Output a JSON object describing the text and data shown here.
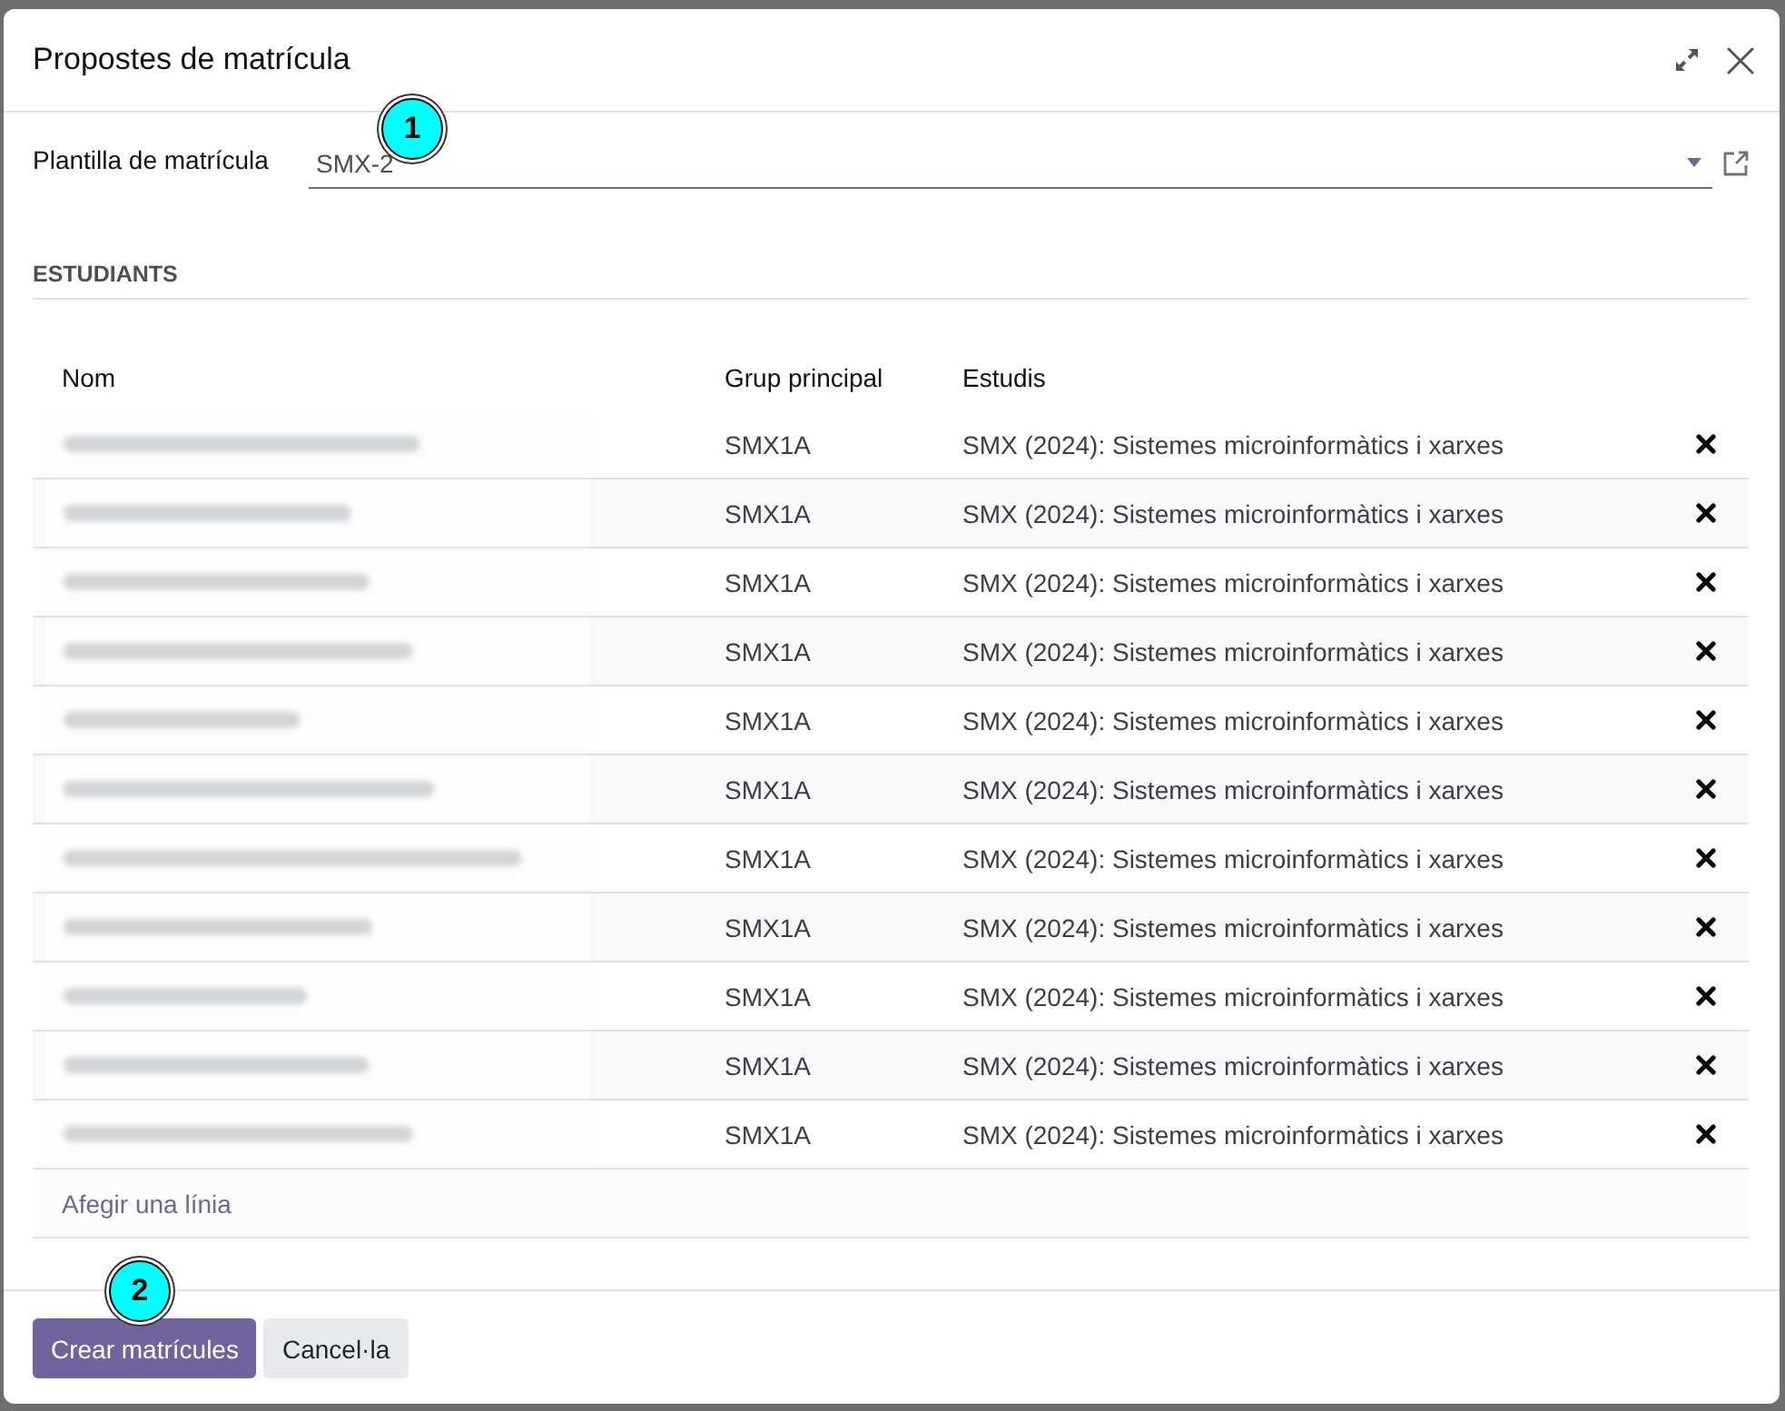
{
  "dialog": {
    "title": "Propostes de matrícula"
  },
  "template_field": {
    "label": "Plantilla de matrícula",
    "value": "SMX-2",
    "callout": "1"
  },
  "students": {
    "section_title": "ESTUDIANTS",
    "columns": [
      "Nom",
      "Grup principal",
      "Estudis"
    ],
    "rows": [
      {
        "group": "SMX1A",
        "studies": "SMX (2024): Sistemes microinformàtics i xarxes"
      },
      {
        "group": "SMX1A",
        "studies": "SMX (2024): Sistemes microinformàtics i xarxes"
      },
      {
        "group": "SMX1A",
        "studies": "SMX (2024): Sistemes microinformàtics i xarxes"
      },
      {
        "group": "SMX1A",
        "studies": "SMX (2024): Sistemes microinformàtics i xarxes"
      },
      {
        "group": "SMX1A",
        "studies": "SMX (2024): Sistemes microinformàtics i xarxes"
      },
      {
        "group": "SMX1A",
        "studies": "SMX (2024): Sistemes microinformàtics i xarxes"
      },
      {
        "group": "SMX1A",
        "studies": "SMX (2024): Sistemes microinformàtics i xarxes"
      },
      {
        "group": "SMX1A",
        "studies": "SMX (2024): Sistemes microinformàtics i xarxes"
      },
      {
        "group": "SMX1A",
        "studies": "SMX (2024): Sistemes microinformàtics i xarxes"
      },
      {
        "group": "SMX1A",
        "studies": "SMX (2024): Sistemes microinformàtics i xarxes"
      },
      {
        "group": "SMX1A",
        "studies": "SMX (2024): Sistemes microinformàtics i xarxes"
      }
    ],
    "add_line": "Afegir una línia"
  },
  "buttons": [
    {
      "label": "Crear matrícules",
      "kind": "primary",
      "callout": "2"
    },
    {
      "label": "Cancel·la",
      "kind": "secondary"
    }
  ]
}
